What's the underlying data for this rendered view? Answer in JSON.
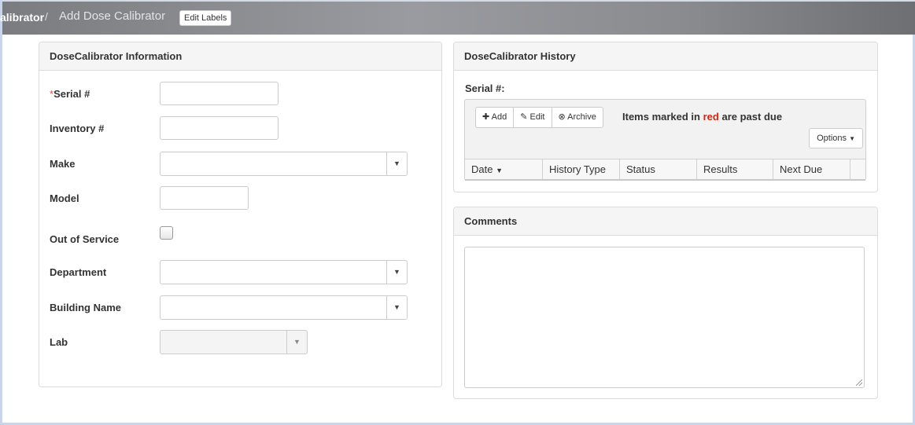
{
  "breadcrumb": {
    "current": "alibrator",
    "separator": "/",
    "page": "Add Dose Calibrator",
    "edit_labels": "Edit Labels"
  },
  "info_panel": {
    "title": "DoseCalibrator Information",
    "fields": {
      "serial": {
        "required_mark": "*",
        "label": "Serial #",
        "value": ""
      },
      "inventory": {
        "label": "Inventory #",
        "value": ""
      },
      "make": {
        "label": "Make",
        "value": ""
      },
      "model": {
        "label": "Model",
        "value": ""
      },
      "out_of_service": {
        "label": "Out of Service",
        "checked": false
      },
      "department": {
        "label": "Department",
        "value": ""
      },
      "building": {
        "label": "Building Name",
        "value": ""
      },
      "lab": {
        "label": "Lab",
        "value": "",
        "disabled": true
      }
    }
  },
  "history_panel": {
    "title": "DoseCalibrator History",
    "serial_label": "Serial #:",
    "toolbar": {
      "add": "Add",
      "edit": "Edit",
      "archive": "Archive"
    },
    "past_due_prefix": "Items marked in",
    "past_due_red": "red",
    "past_due_suffix": "are past due",
    "options": "Options",
    "columns": [
      "Date",
      "History Type",
      "Status",
      "Results",
      "Next Due"
    ]
  },
  "comments_panel": {
    "title": "Comments",
    "value": ""
  },
  "colors": {
    "required": "#d9534f",
    "past_due_red": "#d9230f"
  }
}
